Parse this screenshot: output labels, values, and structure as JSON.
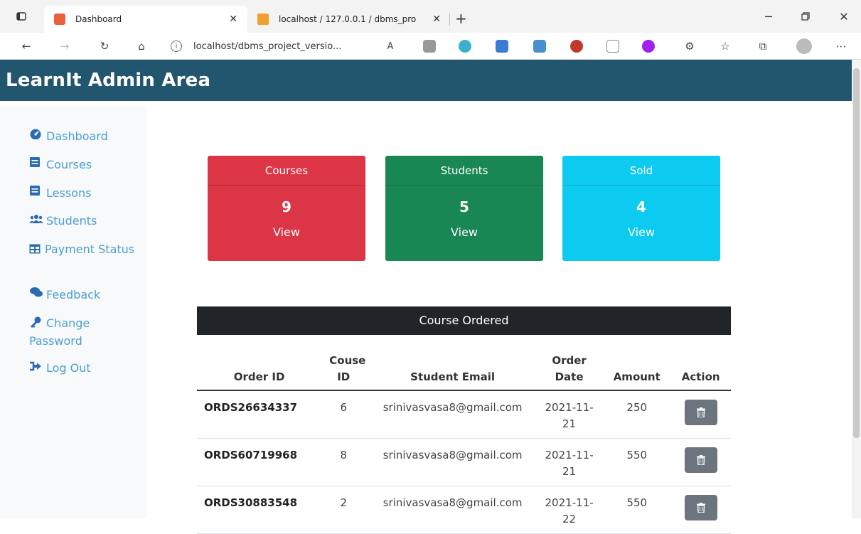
{
  "browser": {
    "tabs": [
      {
        "title": "Dashboard",
        "active": true
      },
      {
        "title": "localhost / 127.0.0.1 / dbms_pro",
        "active": false
      }
    ],
    "address": "localhost/dbms_project_versio..."
  },
  "header": {
    "brand": "LearnIt Admin Area"
  },
  "sidebar": {
    "items": [
      {
        "label": "Dashboard",
        "icon": "tachometer-icon"
      },
      {
        "label": "Courses",
        "icon": "book-icon"
      },
      {
        "label": "Lessons",
        "icon": "book-icon"
      },
      {
        "label": "Students",
        "icon": "users-icon"
      },
      {
        "label": "Payment Status",
        "icon": "table-icon"
      },
      {
        "label": "Feedback",
        "icon": "comments-icon"
      },
      {
        "label": "Change Password",
        "icon": "key-icon"
      },
      {
        "label": "Log Out",
        "icon": "sign-out-icon"
      }
    ]
  },
  "cards": [
    {
      "title": "Courses",
      "value": "9",
      "link": "View",
      "color": "#dc3545"
    },
    {
      "title": "Students",
      "value": "5",
      "link": "View",
      "color": "#198754"
    },
    {
      "title": "Sold",
      "value": "4",
      "link": "View",
      "color": "#0dcaf0"
    }
  ],
  "orders": {
    "title": "Course Ordered",
    "headers": [
      "Order ID",
      "Couse ID",
      "Student Email",
      "Order Date",
      "Amount",
      "Action"
    ],
    "rows": [
      {
        "order_id": "ORDS26634337",
        "course_id": "6",
        "email": "srinivasvasa8@gmail.com",
        "date": "2021-11-21",
        "amount": "250"
      },
      {
        "order_id": "ORDS60719968",
        "course_id": "8",
        "email": "srinivasvasa8@gmail.com",
        "date": "2021-11-21",
        "amount": "550"
      },
      {
        "order_id": "ORDS30883548",
        "course_id": "2",
        "email": "srinivasvasa8@gmail.com",
        "date": "2021-11-22",
        "amount": "550"
      }
    ]
  },
  "colors": {
    "header": "#22566f",
    "link": "#4a9fd4",
    "table_head": "#212529",
    "action_btn": "#6c757d"
  }
}
